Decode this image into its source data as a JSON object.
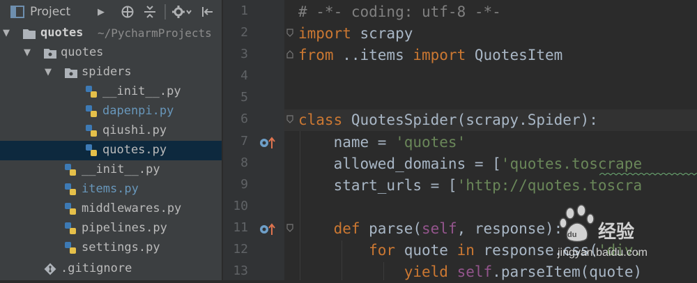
{
  "project_panel": {
    "toolbar": {
      "title": "Project"
    },
    "tree": [
      {
        "label": "quotes",
        "hint": "~/PycharmProjects",
        "type": "folder-root"
      },
      {
        "label": "quotes",
        "type": "package"
      },
      {
        "label": "spiders",
        "type": "package"
      },
      {
        "label": "__init__.py",
        "type": "py"
      },
      {
        "label": "dapenpi.py",
        "type": "py-modified"
      },
      {
        "label": "qiushi.py",
        "type": "py"
      },
      {
        "label": "quotes.py",
        "type": "py-selected"
      },
      {
        "label": "__init__.py",
        "type": "py"
      },
      {
        "label": "items.py",
        "type": "py-modified"
      },
      {
        "label": "middlewares.py",
        "type": "py"
      },
      {
        "label": "pipelines.py",
        "type": "py"
      },
      {
        "label": "settings.py",
        "type": "py"
      },
      {
        "label": ".gitignore",
        "type": "git"
      }
    ]
  },
  "editor": {
    "line_numbers": [
      "1",
      "2",
      "3",
      "4",
      "5",
      "6",
      "7",
      "8",
      "9",
      "10",
      "11",
      "12",
      "13"
    ],
    "code": {
      "l1": "# -*- coding: utf-8 -*-",
      "l2_kw": "import",
      "l2_rest": " scrapy",
      "l3_kw1": "from",
      "l3_mid": " ..items ",
      "l3_kw2": "import",
      "l3_rest": " QuotesItem",
      "l6_kw": "class",
      "l6_rest": " QuotesSpider(scrapy.Spider):",
      "l7_a": "    name = ",
      "l7_str": "'quotes'",
      "l8_a": "    allowed_domains = [",
      "l8_str": "'quotes.toscrape",
      "l9_a": "    start_urls = [",
      "l9_str": "'http://quotes.toscra",
      "l11_kw": "    def",
      "l11_a": " parse(",
      "l11_self": "self",
      "l11_b": ", response):",
      "l12_kw1": "        for",
      "l12_a": " quote ",
      "l12_kw2": "in",
      "l12_b": " response.css(",
      "l12_str": "'div.",
      "l13_kw": "            yield",
      "l13_sp": " ",
      "l13_self": "self",
      "l13_b": ".parseItem(quote)"
    }
  },
  "watermark": {
    "brand": "Bai",
    "cn_text": "经验",
    "url": "jingyan.baidu.com"
  },
  "colors": {
    "keyword": "#cc7832",
    "string": "#6a8759",
    "comment": "#808080",
    "self": "#94558d",
    "selection": "#0d293e"
  }
}
